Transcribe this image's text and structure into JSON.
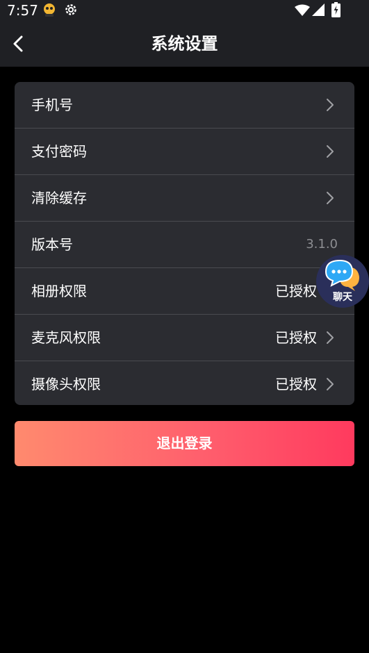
{
  "status_bar": {
    "time": "7:57"
  },
  "header": {
    "title": "系统设置"
  },
  "settings": [
    {
      "label": "手机号",
      "value": "",
      "chevron": true
    },
    {
      "label": "支付密码",
      "value": "",
      "chevron": true
    },
    {
      "label": "清除缓存",
      "value": "",
      "chevron": true
    },
    {
      "label": "版本号",
      "value": "3.1.0",
      "chevron": false
    },
    {
      "label": "相册权限",
      "value": "已授权",
      "chevron": true
    },
    {
      "label": "麦克风权限",
      "value": "已授权",
      "chevron": true
    },
    {
      "label": "摄像头权限",
      "value": "已授权",
      "chevron": true
    }
  ],
  "logout_label": "退出登录",
  "chat_float": {
    "label": "聊天",
    "icon": "chat-bubble-icon"
  },
  "colors": {
    "background": "#000000",
    "bar": "#1f2024",
    "card": "#2b2c31",
    "accent_start": "#ff8a6e",
    "accent_end": "#ff3a5e"
  }
}
